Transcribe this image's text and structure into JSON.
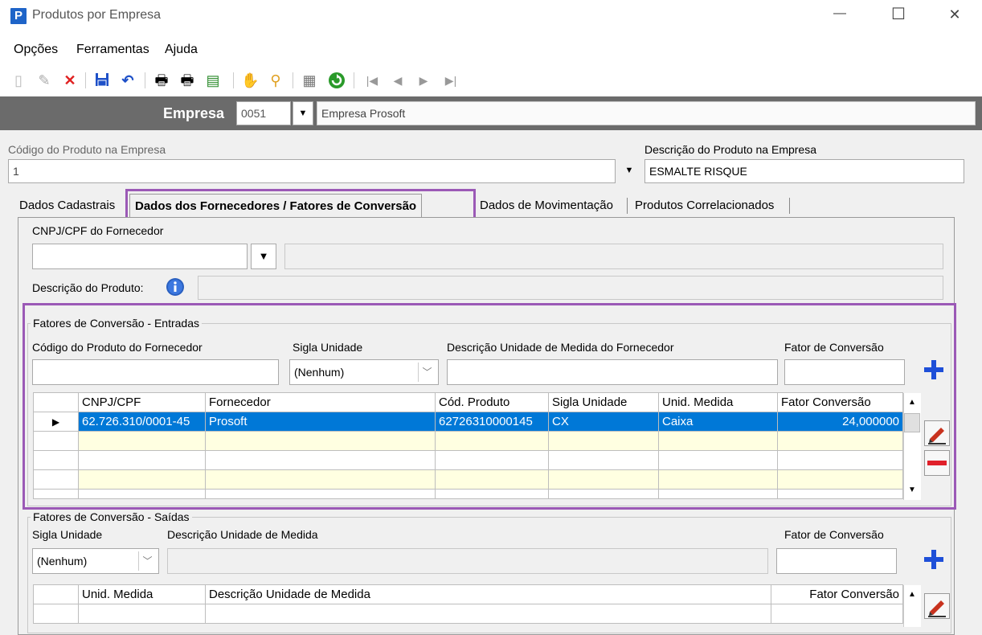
{
  "window": {
    "title": "Produtos por Empresa",
    "icon_letter": "P",
    "minimize": "—",
    "maximize": "☐",
    "close": "✕"
  },
  "menu": {
    "items": [
      "Opções",
      "Ferramentas",
      "Ajuda"
    ]
  },
  "toolbar": {
    "icons": [
      "new-icon",
      "edit-icon",
      "delete-icon",
      "save-icon",
      "undo-icon",
      "print-icon",
      "print-setup-icon",
      "export-icon",
      "hand-icon",
      "find-icon",
      "properties-icon",
      "refresh-icon",
      "first-icon",
      "prev-icon",
      "next-icon",
      "last-icon"
    ]
  },
  "empresa": {
    "label": "Empresa",
    "code": "0051",
    "name": "Empresa Prosoft"
  },
  "produto": {
    "code_label": "Código do Produto na Empresa",
    "code_value": "1",
    "desc_label": "Descrição do Produto na Empresa",
    "desc_value": "ESMALTE RISQUE"
  },
  "tabs": [
    {
      "label": "Dados Cadastrais"
    },
    {
      "label": "Dados dos Fornecedores / Fatores de Conversão"
    },
    {
      "label": "Dados de Movimentação"
    },
    {
      "label": "Produtos Correlacionados"
    }
  ],
  "fornecedor": {
    "cnpj_label": "CNPJ/CPF do Fornecedor",
    "cnpj_value": "",
    "nome_value": "",
    "desc_label": "Descrição do Produto:",
    "desc_value": ""
  },
  "entradas": {
    "title": "Fatores de Conversão - Entradas",
    "cod_label": "Código do Produto do Fornecedor",
    "sigla_label": "Sigla Unidade",
    "sigla_value": "(Nenhum)",
    "desc_label": "Descrição Unidade de Medida do Fornecedor",
    "fator_label": "Fator de Conversão",
    "headers": [
      "CNPJ/CPF",
      "Fornecedor",
      "Cód. Produto",
      "Sigla Unidade",
      "Unid. Medida",
      "Fator Conversão"
    ],
    "rows": [
      [
        "62.726.310/0001-45",
        "Prosoft",
        "62726310000145",
        "CX",
        "Caixa",
        "24,000000"
      ]
    ]
  },
  "saidas": {
    "title": "Fatores de Conversão - Saídas",
    "sigla_label": "Sigla Unidade",
    "sigla_value": "(Nenhum)",
    "desc_label": "Descrição Unidade de Medida",
    "fator_label": "Fator de Conversão",
    "headers": [
      "Unid. Medida",
      "Descrição Unidade de Medida",
      "Fator Conversão"
    ]
  },
  "colors": {
    "accent_purple": "#9b59b6",
    "selection_blue": "#0078d7",
    "empty_row": "#ffffe1",
    "header_bar": "#6b6b6b"
  }
}
